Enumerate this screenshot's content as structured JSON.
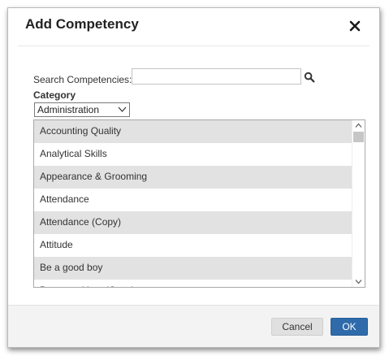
{
  "dialog": {
    "title": "Add Competency",
    "close_icon": "close-icon"
  },
  "search": {
    "label": "Search Competencies:",
    "value": "",
    "placeholder": "",
    "icon": "search-icon"
  },
  "category": {
    "label": "Category",
    "selected": "Administration"
  },
  "competencies": [
    "Accounting Quality",
    "Analytical Skills",
    "Appearance & Grooming",
    "Attendance",
    "Attendance (Copy)",
    "Attitude",
    "Be a good boy",
    "Be a good boy (Copy)"
  ],
  "footer": {
    "cancel_label": "Cancel",
    "ok_label": "OK"
  },
  "colors": {
    "primary": "#2f6bab",
    "row_shade": "#e2e2e2"
  }
}
